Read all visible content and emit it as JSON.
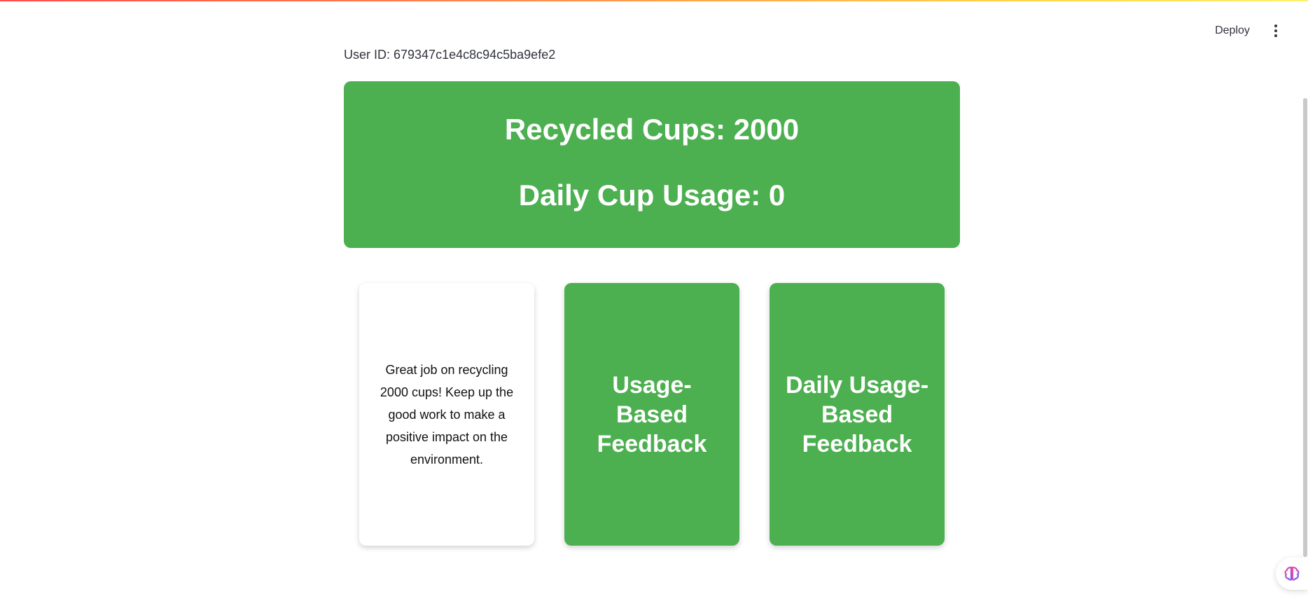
{
  "header": {
    "deploy_label": "Deploy",
    "menu_icon": "kebab-vertical-icon"
  },
  "main": {
    "user_id": "User ID: 679347c1e4c8c94c5ba9efe2",
    "stats": {
      "recycled": "Recycled Cups: 2000",
      "daily": "Daily Cup Usage: 0"
    },
    "cards": [
      {
        "text": "Great job on recycling 2000 cups! Keep up the good work to make a positive impact on the environment."
      },
      {
        "text": "Usage-Based Feedback"
      },
      {
        "text": "Daily Usage-Based Feedback"
      }
    ]
  },
  "colors": {
    "accent_green": "#4caf50",
    "text_dark": "#31333f"
  },
  "assistant_icon": "brain-icon"
}
